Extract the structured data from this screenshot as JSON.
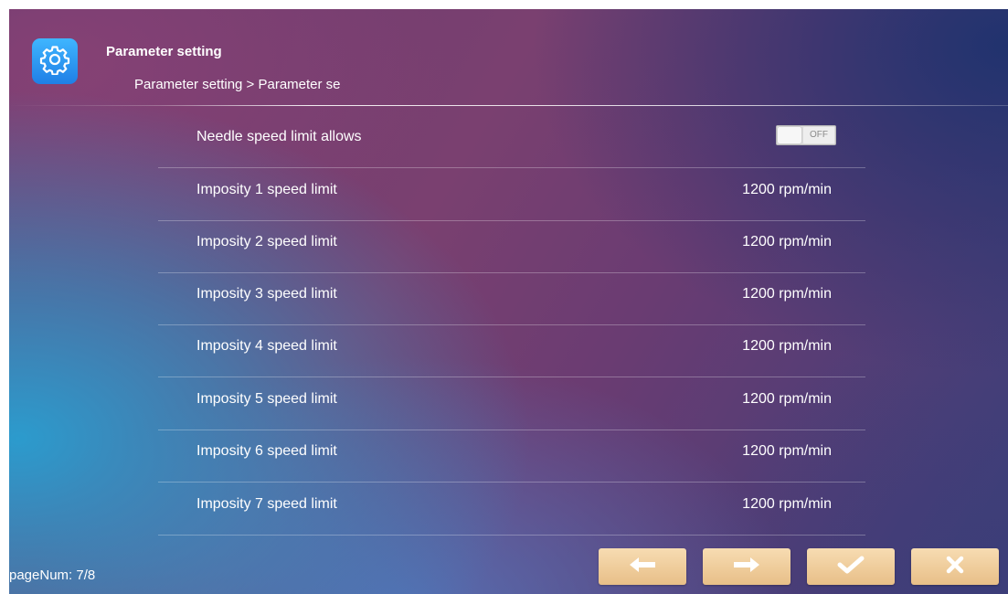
{
  "header": {
    "title": "Parameter setting",
    "breadcrumb": "Parameter setting > Parameter se",
    "icon": "gear-icon"
  },
  "colors": {
    "accent_blue": "#2f97f2",
    "button_beige": "#f1cf9c",
    "toggle_off": "#dcdcdc"
  },
  "parameters": [
    {
      "label": "Needle speed limit allows",
      "toggle": "OFF"
    },
    {
      "label": "Imposity 1 speed limit",
      "value": "1200 rpm/min"
    },
    {
      "label": "Imposity 2 speed limit",
      "value": "1200 rpm/min"
    },
    {
      "label": "Imposity 3 speed limit",
      "value": "1200 rpm/min"
    },
    {
      "label": "Imposity 4 speed limit",
      "value": "1200 rpm/min"
    },
    {
      "label": "Imposity 5 speed limit",
      "value": "1200 rpm/min"
    },
    {
      "label": "Imposity 6 speed limit",
      "value": "1200 rpm/min"
    },
    {
      "label": "Imposity 7 speed limit",
      "value": "1200 rpm/min"
    }
  ],
  "footer": {
    "page_num": "pageNum: 7/8",
    "buttons": {
      "prev": "arrow-left-icon",
      "next": "arrow-right-icon",
      "confirm": "checkmark-icon",
      "close": "close-icon"
    }
  }
}
